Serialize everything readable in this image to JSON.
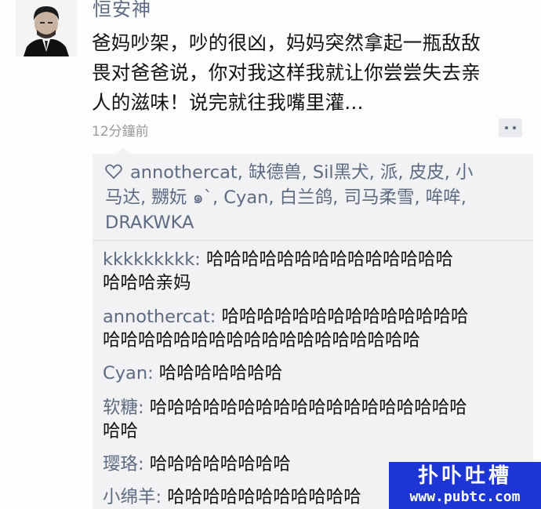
{
  "post": {
    "username": "恒安神",
    "body_lines": [
      "爸妈吵架，吵的很凶，妈妈突然拿起一瓶敌敌",
      "畏对爸爸说，你对我这样我就让你尝尝失去亲",
      "人的滋味！说完就往我嘴里灌..."
    ],
    "time": "12分鐘前",
    "icons": {
      "avatar": "avatar-portrait",
      "comment_toggle": "comment-bubble-icon"
    }
  },
  "likes": {
    "icon": "heart-icon",
    "lines": [
      "annothercat, 缺德兽, Sil黑犬, 派, 皮皮, 小",
      "马达, 嬲妧  ๑`, Cyan, 白兰鸽, 司马柔雪, 哞哞,",
      "DRAKWKA"
    ]
  },
  "comments": [
    {
      "author": "kkkkkkkkk:",
      "lines": [
        " 哈哈哈哈哈哈哈哈哈哈哈哈哈哈",
        "哈哈哈亲妈"
      ]
    },
    {
      "author": "annothercat:",
      "lines": [
        " 哈哈哈哈哈哈哈哈哈哈哈哈哈哈",
        "哈哈哈哈哈哈哈哈哈哈哈哈哈哈哈哈哈哈"
      ]
    },
    {
      "author": "Cyan:",
      "lines": [
        " 哈哈哈哈哈哈哈"
      ]
    },
    {
      "author": "软糖:",
      "lines": [
        " 哈哈哈哈哈哈哈哈哈哈哈哈哈哈哈哈哈哈",
        "哈哈"
      ]
    },
    {
      "author": "璎珞:",
      "lines": [
        " 哈哈哈哈哈哈哈哈"
      ]
    },
    {
      "author": "小绵羊:",
      "lines": [
        " 哈哈哈哈哈哈哈哈哈哈哈"
      ]
    }
  ],
  "watermark": {
    "top": "扑卟吐槽",
    "bottom": "www.pubtc.com"
  }
}
